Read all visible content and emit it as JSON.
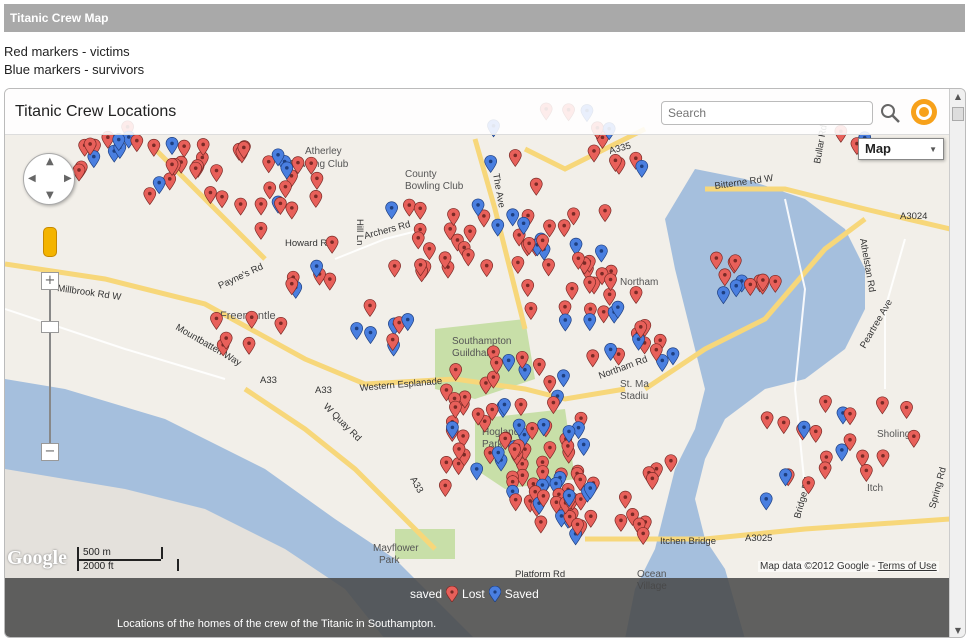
{
  "page": {
    "title": "Titanic Crew Map",
    "legend_line1": "Red markers - victims",
    "legend_line2": "Blue markers - survivors"
  },
  "map": {
    "title": "Titanic Crew Locations",
    "search_placeholder": "Search",
    "map_type": "Map",
    "scale_metric": "500 m",
    "scale_imperial": "2000 ft",
    "google_logo": "Google",
    "attribution": "Map data ©2012 Google",
    "terms_link": "Terms of Use",
    "legend_saved_label": "saved",
    "legend_lost": "Lost",
    "legend_saved": "Saved",
    "caption": "Locations of the homes of the crew of the Titanic in Southampton.",
    "colors": {
      "lost": "#e8605a",
      "saved": "#4a7fe0",
      "road": "#f7d77a",
      "water": "#a5bfdd",
      "park": "#c8dfa8"
    },
    "place_labels": [
      "Atherley Bowling Club",
      "County Bowling Club",
      "Freemantle",
      "Southampton Guildhall",
      "Hoglands Park",
      "St. Mary's Stadium",
      "Mayflower Park",
      "Ocean Village",
      "Northam",
      "Sholing",
      "Itchen"
    ],
    "road_labels": [
      "Millbrook Rd W",
      "Mountbatten Way",
      "A33",
      "W Quay Rd",
      "Western Esplanade",
      "Howard Rd",
      "Archers Rd",
      "Payne's Rd",
      "Bitterne Rd W",
      "A3024",
      "A335",
      "The Ave",
      "Hill Ln",
      "Northam Rd",
      "Itchen Bridge",
      "A3025",
      "Platform Rd",
      "Athelstan Rd",
      "Peartree Ave",
      "Bullar Rd",
      "Bridge Rd",
      "Spring Rd"
    ]
  }
}
